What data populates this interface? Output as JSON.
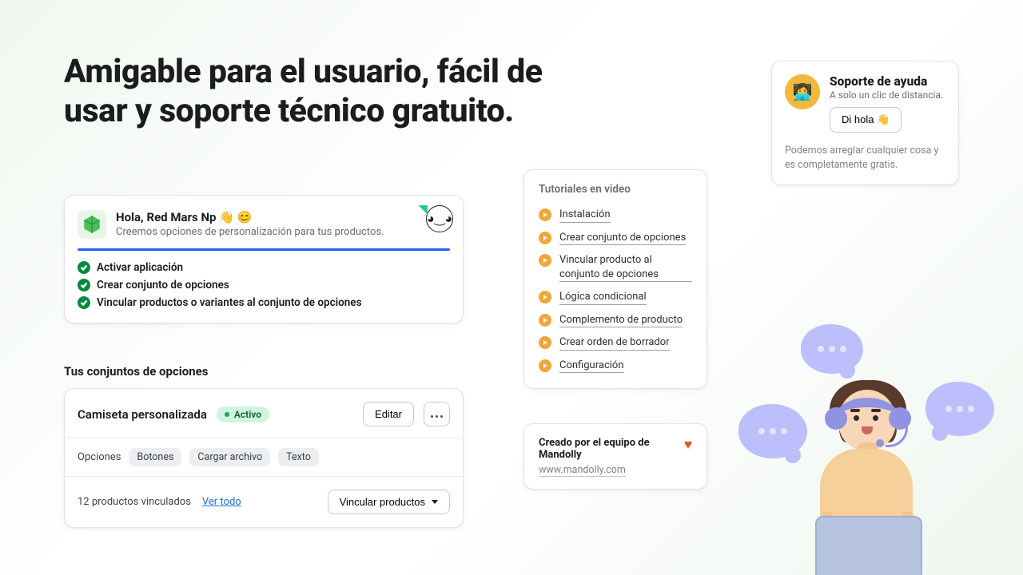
{
  "headline": "Amigable para el usuario, fácil de usar y soporte técnico gratuito.",
  "onboarding": {
    "greeting": "Hola, Red Mars Np 👋 😊",
    "subtitle": "Creemos opciones de personalización para tus productos.",
    "steps": [
      "Activar aplicación",
      "Crear conjunto de opciones",
      "Vincular productos o variantes al conjunto de opciones"
    ]
  },
  "optionSets": {
    "heading": "Tus conjuntos de opciones",
    "item": {
      "name": "Camiseta personalizada",
      "status": "Activo",
      "editLabel": "Editar",
      "optionsLabel": "Opciones",
      "chips": [
        "Botones",
        "Cargar archivo",
        "Texto"
      ],
      "linkedSummary": "12 productos vinculados",
      "viewAll": "Ver todo",
      "linkProducts": "Vincular productos"
    }
  },
  "tutorials": {
    "heading": "Tutoriales en video",
    "items": [
      "Instalación",
      "Crear conjunto de opciones",
      "Vincular producto al conjunto de opciones",
      "Lógica condicional",
      "Complemento de producto",
      "Crear orden de borrador",
      "Configuración"
    ]
  },
  "mandolly": {
    "title": "Creado por el equipo de Mandolly",
    "url": "www.mandolly.com"
  },
  "support": {
    "title": "Soporte de ayuda",
    "subtitle": "A solo un clic de distancia.",
    "cta": "Di hola 👋",
    "footer": "Podemos arreglar cualquier cosa y es completamente gratis."
  }
}
